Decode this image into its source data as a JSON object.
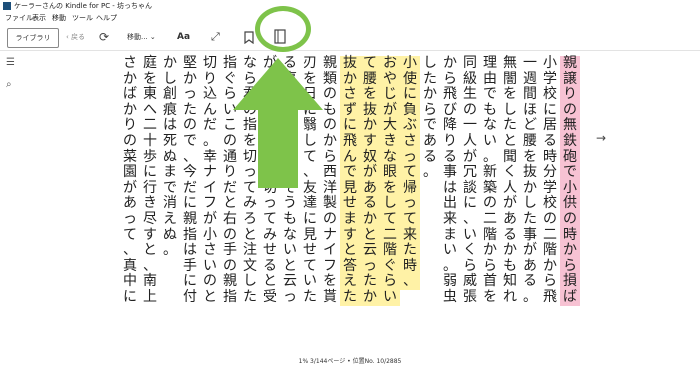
{
  "window": {
    "title": "ケーラーさんの Kindle for PC - 坊っちゃん"
  },
  "menu": [
    "ファイル",
    "表示",
    "移動",
    "ツール",
    "ヘルプ"
  ],
  "toolbar": {
    "library_label": "ライブラリ",
    "back_label": "戻る",
    "move_label": "移動...",
    "font_label": "Aa"
  },
  "reader": {
    "columns": [
      {
        "text": "親譲りの無鉄砲で小供の時から損ばかりしている。",
        "highlight": "pink"
      },
      {
        "text": "小学校に居る時分学校の二階から飛び降りて",
        "highlight": "none"
      },
      {
        "text": "一週間ほど腰を抜かした事がある。なぜそんな",
        "highlight": "none"
      },
      {
        "text": "無闇をしたと聞く人があるかも知れぬ。別段深い",
        "highlight": "none"
      },
      {
        "text": "理由でもない。新築の二階から首を出していたら、",
        "highlight": "none"
      },
      {
        "text": "同級生の一人が冗談に、いくら威張っても、そこ",
        "highlight": "none"
      },
      {
        "text": "から飛び降りる事は出来まい。弱虫やーい。と囃",
        "highlight": "none"
      },
      {
        "text": "したからである。",
        "highlight": "none"
      },
      {
        "text": "小使に負ぶさって帰って来た時、",
        "highlight": "yellow"
      },
      {
        "text": "おやじが大きな眼をして二階ぐらいから飛び降り",
        "highlight": "yellow"
      },
      {
        "text": "て腰を抜かす奴があるかと云ったから、この次は",
        "highlight": "yellow"
      },
      {
        "text": "抜かさずに飛んで見せますと答えた。",
        "highlight": "yellow"
      },
      {
        "text": "親類のものから西洋製のナイフを貰って奇麗な",
        "highlight": "none"
      },
      {
        "text": "刃を日に翳して、友達に見せていたら、一人が光",
        "highlight": "none"
      },
      {
        "text": "る事は光るが切れそうもないと云った。切れぬ事",
        "highlight": "none"
      },
      {
        "text": "があるか、何でも切ってみせると受け合った。そん",
        "highlight": "none"
      },
      {
        "text": "なら君の指を切ってみろと注文したから、何だ",
        "highlight": "none"
      },
      {
        "text": "指ぐらいこの通りだと右の手の親指の甲をはすに",
        "highlight": "none"
      },
      {
        "text": "切り込んだ。幸ナイフが小さいのと、親指の骨が",
        "highlight": "none"
      },
      {
        "text": "堅かったので、今だに親指は手に付いている。し",
        "highlight": "none"
      },
      {
        "text": "かし創痕は死ぬまで消えぬ。",
        "highlight": "none"
      },
      {
        "text": "庭を東へ二十歩に行き尽すと、南上がりにいさ",
        "highlight": "none"
      },
      {
        "text": "さかばかりの菜園があって、真中に栗の木が一本",
        "highlight": "none"
      }
    ]
  },
  "footer": {
    "status": "1%   3/144ページ • 位置No. 10/2885"
  },
  "colors": {
    "pink_highlight": "#f7c2d3",
    "yellow_highlight": "#fff2a6",
    "annotation_green": "#7ec34a"
  }
}
